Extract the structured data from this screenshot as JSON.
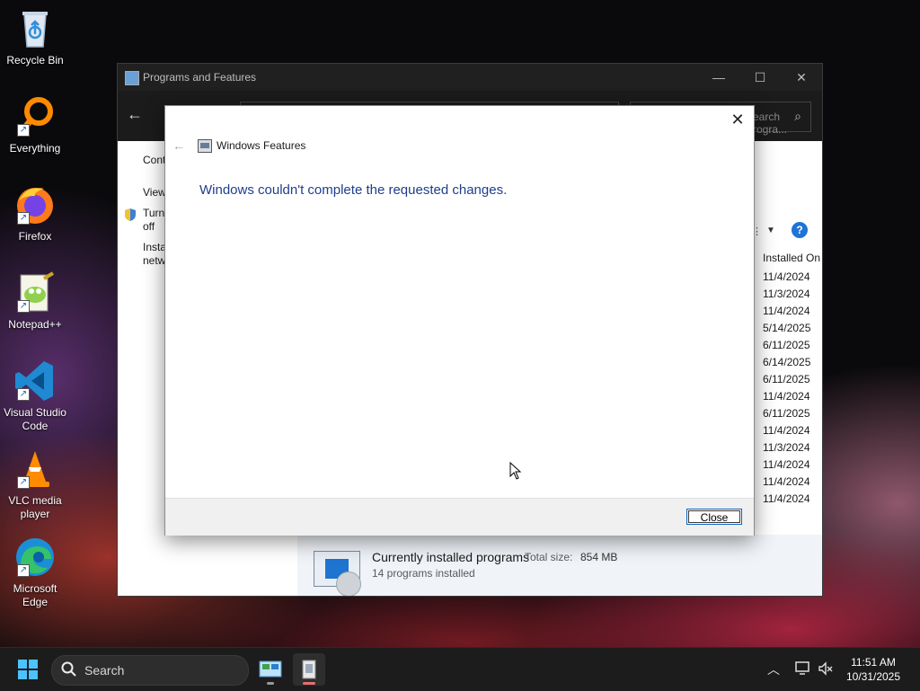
{
  "desktop": {
    "icons": [
      {
        "label": "Recycle Bin",
        "icon": "recycle-bin-icon"
      },
      {
        "label": "Everything",
        "icon": "everything-search-icon"
      },
      {
        "label": "Firefox",
        "icon": "firefox-icon"
      },
      {
        "label": "Notepad++",
        "icon": "notepadpp-icon"
      },
      {
        "label": "Visual Studio Code",
        "icon": "vscode-icon"
      },
      {
        "label": "VLC media player",
        "icon": "vlc-icon"
      },
      {
        "label": "Microsoft Edge",
        "icon": "edge-icon"
      }
    ]
  },
  "programs_window": {
    "title": "Programs and Features",
    "search_placeholder": "Search Progra...",
    "left_links": {
      "control_panel": "Cont",
      "view": "View",
      "turn_line1": "Turn",
      "turn_line2": "off",
      "install_line1": "Insta",
      "install_line2": "netw"
    },
    "column_installed_on": "Installed On",
    "installed_dates": [
      "11/4/2024",
      "11/3/2024",
      "11/4/2024",
      "5/14/2025",
      "6/11/2025",
      "6/14/2025",
      "6/11/2025",
      "11/4/2024",
      "6/11/2025",
      "11/4/2024",
      "11/3/2024",
      "11/4/2024",
      "11/4/2024",
      "11/4/2024"
    ],
    "status": {
      "title": "Currently installed programs",
      "total_size_label": "Total size:",
      "total_size_value": "854 MB",
      "count": "14 programs installed"
    }
  },
  "dialog": {
    "title": "Windows Features",
    "message": "Windows couldn't complete the requested changes.",
    "close_button": "Close"
  },
  "taskbar": {
    "search_placeholder": "Search",
    "time": "11:51 AM",
    "date": "10/31/2025"
  },
  "colors": {
    "dialog_message": "#1e3e8c",
    "accent": "#0a64c8",
    "taskbar": "#1c1c1c"
  }
}
